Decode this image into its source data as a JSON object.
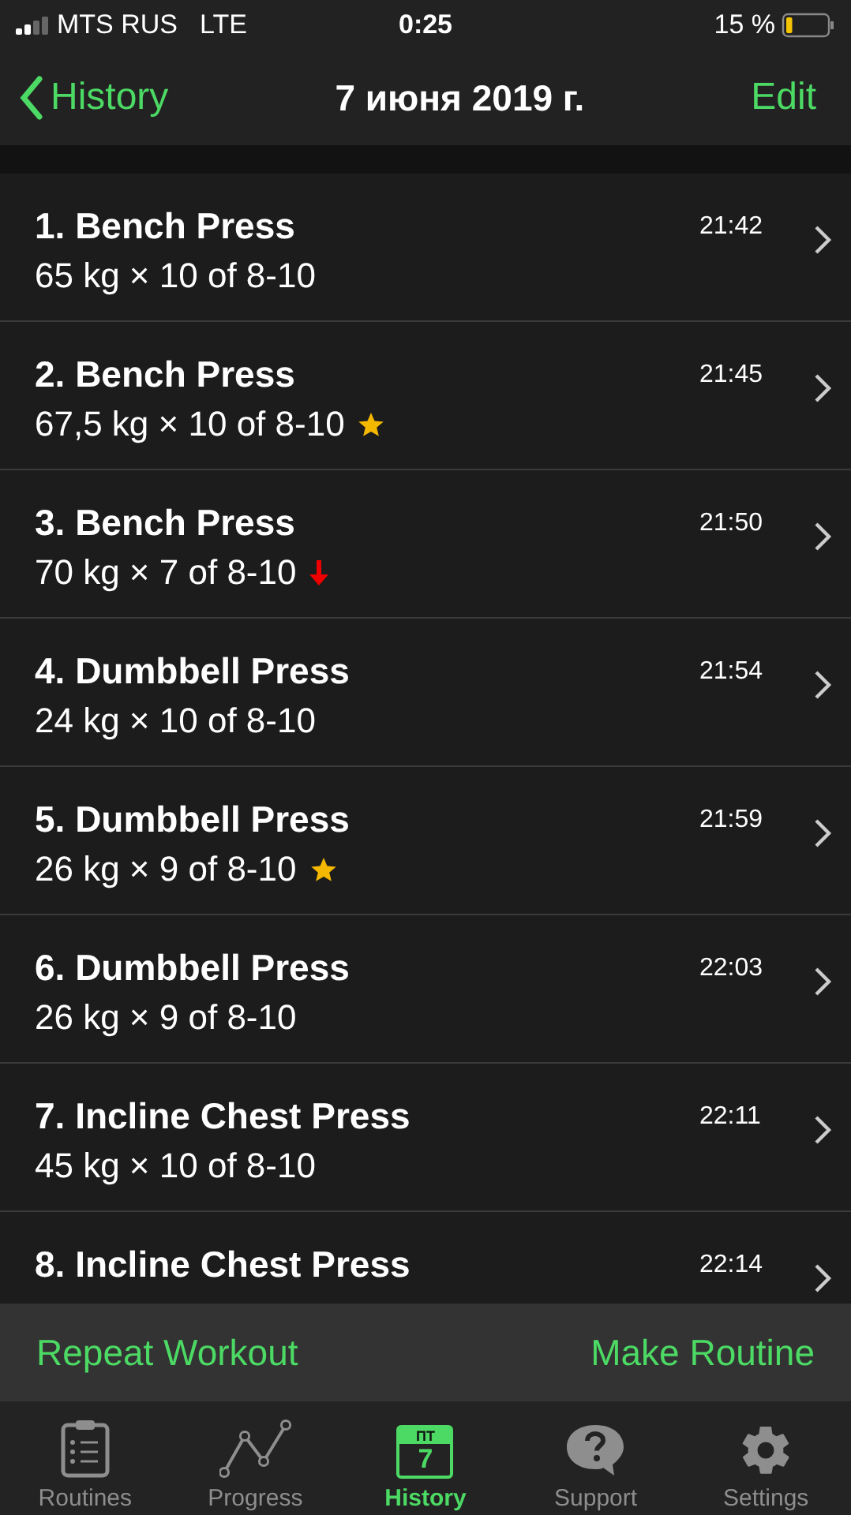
{
  "status_bar": {
    "carrier": "MTS RUS",
    "network": "LTE",
    "time": "0:25",
    "battery": "15 %"
  },
  "nav": {
    "back": "History",
    "title": "7 июня 2019 г.",
    "action": "Edit"
  },
  "sets": [
    {
      "title": "1. Bench Press",
      "time": "21:42",
      "detail": "65 kg × 10 of 8-10",
      "kind": "plain"
    },
    {
      "title": "2. Bench Press",
      "time": "21:45",
      "detail": "67,5 kg × 10 of 8-10",
      "kind": "star"
    },
    {
      "title": "3. Bench Press",
      "time": "21:50",
      "detail": "70 kg × 7 of 8-10",
      "kind": "down"
    },
    {
      "title": "4. Dumbbell Press",
      "time": "21:54",
      "detail": "24 kg × 10 of 8-10",
      "kind": "plain"
    },
    {
      "title": "5. Dumbbell Press",
      "time": "21:59",
      "detail": "26 kg × 9 of 8-10",
      "kind": "star"
    },
    {
      "title": "6. Dumbbell Press",
      "time": "22:03",
      "detail": "26 kg × 9 of 8-10",
      "kind": "plain"
    },
    {
      "title": "7. Incline Chest Press",
      "time": "22:11",
      "detail": "45 kg × 10 of 8-10",
      "kind": "plain"
    },
    {
      "title": "8. Incline Chest Press",
      "time": "22:14"
    }
  ],
  "actions": [
    "Repeat Workout",
    "Make Routine"
  ],
  "tabs": [
    {
      "label": "Routines",
      "kind": "clipboard",
      "selected": false
    },
    {
      "label": "Progress",
      "kind": "chart",
      "selected": false
    },
    {
      "label": "History",
      "kind": "calendar",
      "selected": true,
      "icon_day": "ПТ",
      "icon_date": "7"
    },
    {
      "label": "Support",
      "kind": "help",
      "selected": false
    },
    {
      "label": "Settings",
      "kind": "gear",
      "selected": false
    }
  ]
}
